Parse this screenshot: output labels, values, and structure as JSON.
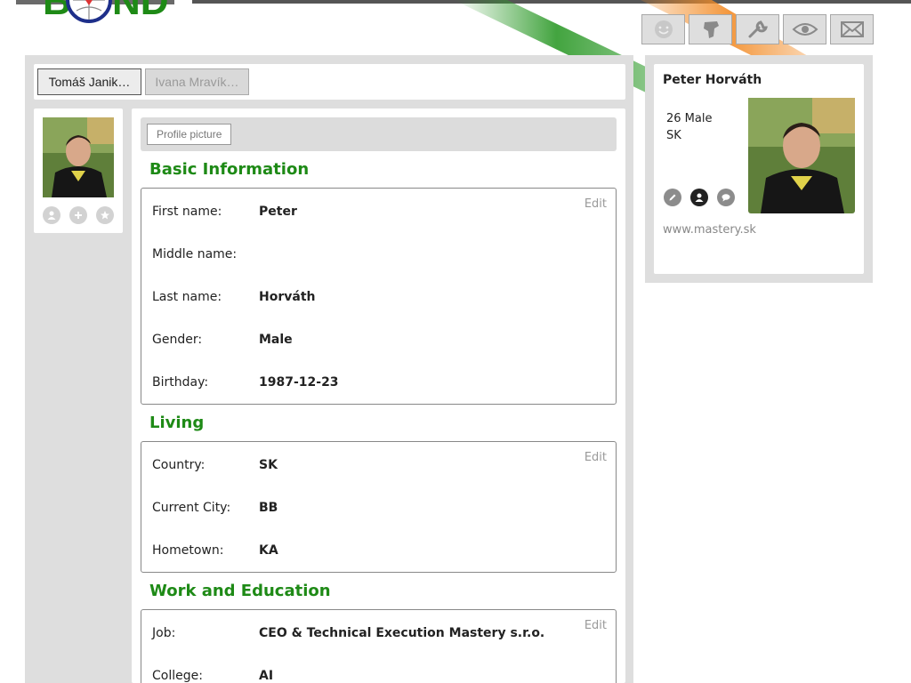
{
  "header": {
    "icons": [
      "smiley-icon",
      "map-icon",
      "wrench-icon",
      "eye-icon",
      "envelope-icon"
    ]
  },
  "tabs": [
    {
      "label": "Tomáš Janik…",
      "active": true
    },
    {
      "label": "Ivana Mravík…",
      "active": false
    }
  ],
  "sidebar": {
    "icons": [
      "user-icon",
      "add-icon",
      "star-icon"
    ]
  },
  "profile_picture_button": "Profile picture",
  "sections": {
    "basic": {
      "title": "Basic Information",
      "edit": "Edit",
      "rows": [
        {
          "label": "First name:",
          "value": "Peter"
        },
        {
          "label": "Middle name:",
          "value": ""
        },
        {
          "label": "Last name:",
          "value": "Horváth"
        },
        {
          "label": "Gender:",
          "value": "Male"
        },
        {
          "label": "Birthday:",
          "value": "1987-12-23"
        }
      ]
    },
    "living": {
      "title": "Living",
      "edit": "Edit",
      "rows": [
        {
          "label": "Country:",
          "value": "SK"
        },
        {
          "label": "Current City:",
          "value": "BB"
        },
        {
          "label": "Hometown:",
          "value": "KA"
        }
      ]
    },
    "work": {
      "title": "Work and Education",
      "edit": "Edit",
      "rows": [
        {
          "label": "Job:",
          "value": "CEO & Technical Execution Mastery s.r.o."
        },
        {
          "label": "College:",
          "value": "AI"
        }
      ]
    }
  },
  "right_card": {
    "name": "Peter Horváth",
    "age_gender": "26 Male",
    "country": "SK",
    "website": "www.mastery.sk",
    "icons": [
      "pencil-icon",
      "user-icon",
      "chat-icon"
    ]
  },
  "colors": {
    "section_title": "#1e8a16",
    "panel_bg": "#dedede",
    "stripe_green": "#2e9a2a",
    "stripe_orange": "#f28c28"
  }
}
